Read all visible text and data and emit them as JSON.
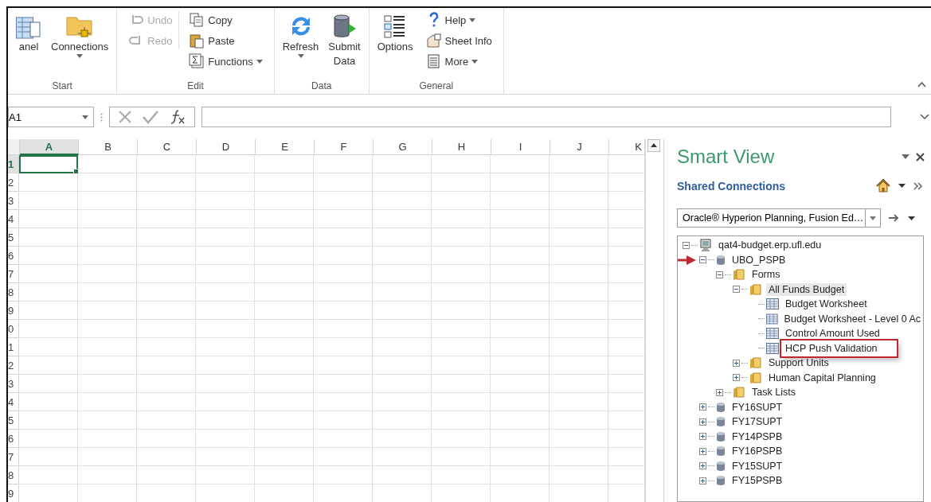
{
  "ribbon": {
    "groups": [
      {
        "label": "Start",
        "buttons": [
          {
            "label": "anel",
            "dropdown": false,
            "disabled": false
          },
          {
            "label": "Connections",
            "dropdown": true,
            "disabled": false
          }
        ]
      },
      {
        "label": "Edit",
        "small": [
          [
            {
              "label": "Undo",
              "dropdown": false,
              "disabled": true
            },
            {
              "label": "Redo",
              "dropdown": false,
              "disabled": true
            }
          ],
          [
            {
              "label": "Copy",
              "dropdown": false,
              "disabled": false
            },
            {
              "label": "Paste",
              "dropdown": false,
              "disabled": false
            },
            {
              "label": "Functions",
              "dropdown": true,
              "disabled": false
            }
          ]
        ]
      },
      {
        "label": "Data",
        "buttons": [
          {
            "label": "Refresh",
            "dropdown": true,
            "disabled": false
          },
          {
            "label": "Submit Data",
            "dropdown": false,
            "disabled": false
          }
        ]
      },
      {
        "label": "General",
        "buttons": [
          {
            "label": "Options",
            "dropdown": false,
            "disabled": false
          }
        ],
        "small": [
          [
            {
              "label": "Help",
              "dropdown": true,
              "disabled": false
            },
            {
              "label": "Sheet Info",
              "dropdown": false,
              "disabled": false
            },
            {
              "label": "More",
              "dropdown": true,
              "disabled": false
            }
          ]
        ]
      }
    ]
  },
  "formula_bar": {
    "name_box": "A1"
  },
  "sheet": {
    "columns": [
      {
        "label": "A",
        "selected": true
      },
      {
        "label": "B",
        "selected": false
      },
      {
        "label": "C",
        "selected": false
      },
      {
        "label": "D",
        "selected": false
      },
      {
        "label": "E",
        "selected": false
      },
      {
        "label": "F",
        "selected": false
      },
      {
        "label": "G",
        "selected": false
      },
      {
        "label": "H",
        "selected": false
      },
      {
        "label": "I",
        "selected": false
      },
      {
        "label": "J",
        "selected": false
      },
      {
        "label": "K",
        "selected": false
      }
    ],
    "rows": [
      {
        "label": "1",
        "selected": true
      },
      {
        "label": "2",
        "selected": false
      },
      {
        "label": "3",
        "selected": false
      },
      {
        "label": "4",
        "selected": false
      },
      {
        "label": "5",
        "selected": false
      },
      {
        "label": "6",
        "selected": false
      },
      {
        "label": "7",
        "selected": false
      },
      {
        "label": "8",
        "selected": false
      },
      {
        "label": "9",
        "selected": false
      },
      {
        "label": "0",
        "selected": false
      },
      {
        "label": "1",
        "selected": false
      },
      {
        "label": "2",
        "selected": false
      },
      {
        "label": "3",
        "selected": false
      },
      {
        "label": "4",
        "selected": false
      },
      {
        "label": "5",
        "selected": false
      },
      {
        "label": "6",
        "selected": false
      },
      {
        "label": "7",
        "selected": false
      },
      {
        "label": "8",
        "selected": false
      },
      {
        "label": "9",
        "selected": false
      }
    ]
  },
  "smart_view": {
    "title": "Smart View",
    "section": "Shared Connections",
    "provider": "Oracle® Hyperion Planning, Fusion Ed…",
    "tree": [
      {
        "label": "qat4-budget.erp.ufl.edu",
        "kind": "server",
        "expanded": true,
        "selected": false,
        "callout": false,
        "arrow": false,
        "children": [
          {
            "label": "UBO_PSPB",
            "kind": "database",
            "expanded": true,
            "selected": false,
            "callout": false,
            "arrow": true,
            "children": [
              {
                "label": "Forms",
                "kind": "folder",
                "expanded": true,
                "selected": false,
                "callout": false,
                "arrow": false,
                "children": [
                  {
                    "label": "All Funds Budget",
                    "kind": "folder",
                    "expanded": true,
                    "selected": true,
                    "callout": false,
                    "arrow": false,
                    "children": [
                      {
                        "label": "Budget Worksheet",
                        "kind": "form",
                        "selected": false,
                        "callout": false,
                        "arrow": false
                      },
                      {
                        "label": "Budget Worksheet - Level 0 Ac",
                        "kind": "form",
                        "selected": false,
                        "callout": false,
                        "arrow": false
                      },
                      {
                        "label": "Control Amount Used",
                        "kind": "form",
                        "selected": false,
                        "callout": false,
                        "arrow": false
                      },
                      {
                        "label": "HCP Push Validation",
                        "kind": "form",
                        "selected": false,
                        "callout": true,
                        "arrow": false
                      }
                    ]
                  },
                  {
                    "label": "Support Units",
                    "kind": "folder",
                    "expanded": false,
                    "selected": false,
                    "callout": false,
                    "arrow": false
                  },
                  {
                    "label": "Human Capital Planning",
                    "kind": "folder",
                    "expanded": false,
                    "selected": false,
                    "callout": false,
                    "arrow": false
                  }
                ]
              },
              {
                "label": "Task Lists",
                "kind": "folder",
                "expanded": false,
                "selected": false,
                "callout": false,
                "arrow": false
              }
            ]
          },
          {
            "label": "FY16SUPT",
            "kind": "database",
            "expanded": false,
            "selected": false,
            "callout": false,
            "arrow": false
          },
          {
            "label": "FY17SUPT",
            "kind": "database",
            "expanded": false,
            "selected": false,
            "callout": false,
            "arrow": false
          },
          {
            "label": "FY14PSPB",
            "kind": "database",
            "expanded": false,
            "selected": false,
            "callout": false,
            "arrow": false
          },
          {
            "label": "FY16PSPB",
            "kind": "database",
            "expanded": false,
            "selected": false,
            "callout": false,
            "arrow": false
          },
          {
            "label": "FY15SUPT",
            "kind": "database",
            "expanded": false,
            "selected": false,
            "callout": false,
            "arrow": false
          },
          {
            "label": "FY15PSPB",
            "kind": "database",
            "expanded": false,
            "selected": false,
            "callout": false,
            "arrow": false
          }
        ]
      }
    ]
  }
}
